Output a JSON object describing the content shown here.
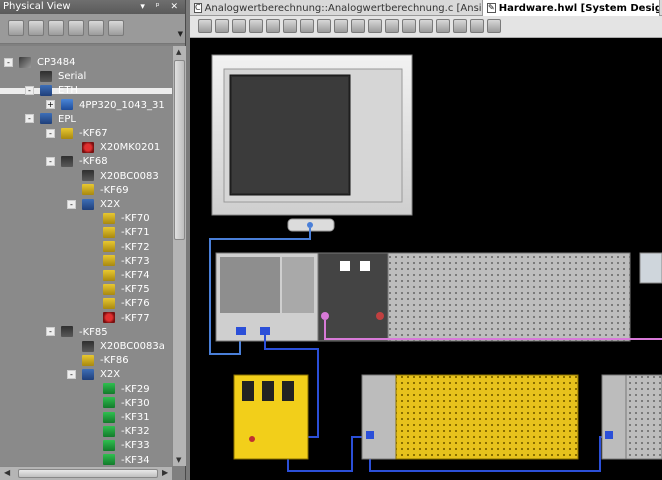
{
  "physical_view": {
    "title": "Physical View",
    "header_controls": "▾ ᵖ ✕",
    "toolbar_icons": [
      "new-icon",
      "open-icon",
      "properties-icon",
      "add-module-icon",
      "connect-icon",
      "search-icon"
    ],
    "tree": [
      {
        "label": "CP3484",
        "indent": 0,
        "icon": "cpu-icon",
        "expander": "-"
      },
      {
        "label": "Serial",
        "indent": 1,
        "icon": "serial-port-icon",
        "expander": ""
      },
      {
        "label": "ETH",
        "indent": 1,
        "icon": "ethernet-icon",
        "expander": "-"
      },
      {
        "label": "4PP320_1043_31",
        "indent": 2,
        "icon": "panel-icon",
        "expander": "+"
      },
      {
        "label": "EPL",
        "indent": 1,
        "icon": "powerlink-icon",
        "expander": "-"
      },
      {
        "label": "-KF67",
        "indent": 2,
        "icon": "module-icon",
        "expander": "-"
      },
      {
        "label": "X20MK0201",
        "indent": 3,
        "icon": "safety-module-icon",
        "expander": ""
      },
      {
        "label": "-KF68",
        "indent": 2,
        "icon": "bus-controller-icon",
        "expander": "-"
      },
      {
        "label": "X20BC0083",
        "indent": 3,
        "icon": "bus-controller-icon",
        "expander": ""
      },
      {
        "label": "-KF69",
        "indent": 3,
        "icon": "bus-module-icon",
        "expander": ""
      },
      {
        "label": "X2X",
        "indent": 3,
        "icon": "x2x-icon",
        "expander": "-"
      },
      {
        "label": "-KF70",
        "indent": 4,
        "icon": "module-icon",
        "expander": ""
      },
      {
        "label": "-KF71",
        "indent": 4,
        "icon": "module-icon",
        "expander": ""
      },
      {
        "label": "-KF72",
        "indent": 4,
        "icon": "module-icon",
        "expander": ""
      },
      {
        "label": "-KF73",
        "indent": 4,
        "icon": "module-icon",
        "expander": ""
      },
      {
        "label": "-KF74",
        "indent": 4,
        "icon": "module-icon",
        "expander": ""
      },
      {
        "label": "-KF75",
        "indent": 4,
        "icon": "module-icon",
        "expander": ""
      },
      {
        "label": "-KF76",
        "indent": 4,
        "icon": "module-icon",
        "expander": ""
      },
      {
        "label": "-KF77",
        "indent": 4,
        "icon": "safety-module-icon",
        "expander": ""
      },
      {
        "label": "-KF85",
        "indent": 2,
        "icon": "bus-controller-icon",
        "expander": "-"
      },
      {
        "label": "X20BC0083a",
        "indent": 3,
        "icon": "bus-controller-icon",
        "expander": ""
      },
      {
        "label": "-KF86",
        "indent": 3,
        "icon": "bus-module-icon",
        "expander": ""
      },
      {
        "label": "X2X",
        "indent": 3,
        "icon": "x2x-icon",
        "expander": "-"
      },
      {
        "label": "-KF29",
        "indent": 4,
        "icon": "io-module-icon",
        "expander": ""
      },
      {
        "label": "-KF30",
        "indent": 4,
        "icon": "io-module-icon",
        "expander": ""
      },
      {
        "label": "-KF31",
        "indent": 4,
        "icon": "io-module-icon",
        "expander": ""
      },
      {
        "label": "-KF32",
        "indent": 4,
        "icon": "io-module-icon",
        "expander": ""
      },
      {
        "label": "-KF33",
        "indent": 4,
        "icon": "io-module-icon",
        "expander": ""
      },
      {
        "label": "-KF34",
        "indent": 4,
        "icon": "io-module-icon",
        "expander": ""
      }
    ]
  },
  "tabs": [
    {
      "label": "Analogwertberechnung::Analogwertberechnung.c [Ansi C]",
      "icon": "c-file-icon",
      "active": false
    },
    {
      "label": "Hardware.hwl [System Designer]",
      "icon": "hardware-icon",
      "active": true
    }
  ],
  "editor_toolbar_icons": [
    "save-icon",
    "zoom-in-icon",
    "zoom-out-icon",
    "fit-icon",
    "lock-icon",
    "pointer-icon",
    "align-left-icon",
    "align-center-icon",
    "align-right-icon",
    "align-top-icon",
    "align-middle-icon",
    "align-bottom-icon",
    "distribute-h-icon",
    "distribute-v-icon",
    "grid-icon",
    "search-icon",
    "settings-icon",
    "refresh-icon"
  ],
  "colors": {
    "canvas": "#000000",
    "powerlink_cable": "#2b4fd8",
    "ethernet_cable": "#4a7fd8",
    "safety_yellow": "#f2cf1a",
    "module_gray": "#c9c9c9",
    "cable_pink": "#d87ad8"
  }
}
